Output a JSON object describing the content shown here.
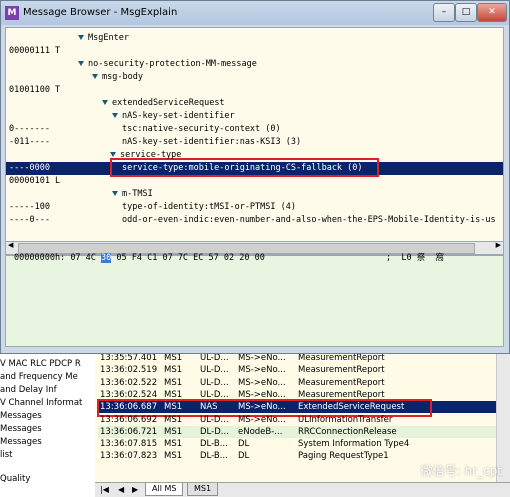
{
  "background": {
    "left_items": [
      "V MAC RLC PDCP R",
      "and Frequency Me",
      "and Delay Inf",
      "V Channel Informat",
      "Messages",
      "Messages",
      "Messages",
      "list",
      "Quality"
    ],
    "rows": [
      {
        "time": "13:35:57.401",
        "ms": "MS1",
        "ch": "UL-D...",
        "dir": "MS->eNo...",
        "msg": "MeasurementReport"
      },
      {
        "time": "13:36:02.519",
        "ms": "MS1",
        "ch": "UL-D...",
        "dir": "MS->eNo...",
        "msg": "MeasurementReport"
      },
      {
        "time": "13:36:02.522",
        "ms": "MS1",
        "ch": "UL-D...",
        "dir": "MS->eNo...",
        "msg": "MeasurementReport"
      },
      {
        "time": "13:36:02.524",
        "ms": "MS1",
        "ch": "UL-D...",
        "dir": "MS->eNo...",
        "msg": "MeasurementReport"
      },
      {
        "time": "13:36:06.687",
        "ms": "MS1",
        "ch": "NAS",
        "dir": "MS->eNo...",
        "msg": "ExtendedServiceRequest"
      },
      {
        "time": "13:36:06.692",
        "ms": "MS1",
        "ch": "UL-D...",
        "dir": "MS->eNo...",
        "msg": "ULInformationTransfer"
      },
      {
        "time": "13:36:06.721",
        "ms": "MS1",
        "ch": "DL-D...",
        "dir": "eNodeB-...",
        "msg": "RRCConnectionRelease"
      },
      {
        "time": "13:36:07.815",
        "ms": "MS1",
        "ch": "DL-B...",
        "dir": "DL",
        "msg": "System Information Type4"
      },
      {
        "time": "13:36:07.823",
        "ms": "MS1",
        "ch": "DL-B...",
        "dir": "DL",
        "msg": "Paging RequestType1"
      }
    ],
    "tabs": [
      "All MS",
      "MS1"
    ]
  },
  "dialog": {
    "title": "Message Browser - MsgExplain",
    "tree": [
      {
        "bits": "",
        "text": "MsgEnter",
        "arrow": true
      },
      {
        "bits": "00000111 T",
        "text": ""
      },
      {
        "bits": "",
        "text": "no-security-protection-MM-message",
        "arrow": true
      },
      {
        "bits": "",
        "text": "msg-body",
        "arrow": true
      },
      {
        "bits": "01001100 T",
        "text": ""
      },
      {
        "bits": "",
        "text": "extendedServiceRequest",
        "arrow": true
      },
      {
        "bits": "",
        "text": "nAS-key-set-identifier",
        "arrow": true
      },
      {
        "bits": "0-------",
        "text": "tsc:native-security-context (0)"
      },
      {
        "bits": "-011----",
        "text": "nAS-key-set-identifier:nas-KSI3 (3)"
      },
      {
        "bits": "",
        "text": "service-type",
        "arrow": true
      },
      {
        "bits": "----0000",
        "text": "service-type:mobile-originating-CS-fallback (0)"
      },
      {
        "bits": "00000101 L",
        "text": ""
      },
      {
        "bits": "",
        "text": "m-TMSI",
        "arrow": true
      },
      {
        "bits": "-----100",
        "text": "type-of-identity:tMSI-or-PTMSI (4)"
      },
      {
        "bits": "----0---",
        "text": "odd-or-even-indic:even-number-and-also-when-the-EPS-Mobile-Identity-is-us"
      }
    ],
    "hex": {
      "offset": "00000000h:",
      "before": "07 4C",
      "highlight": "30",
      "after": "05 F4 C1 07 7C EC 57 02 20 00",
      "ascii": "; ‌‌ L0 ‌祭 ‌ 窩 "
    }
  },
  "watermark": "微信号: hr_cpt"
}
